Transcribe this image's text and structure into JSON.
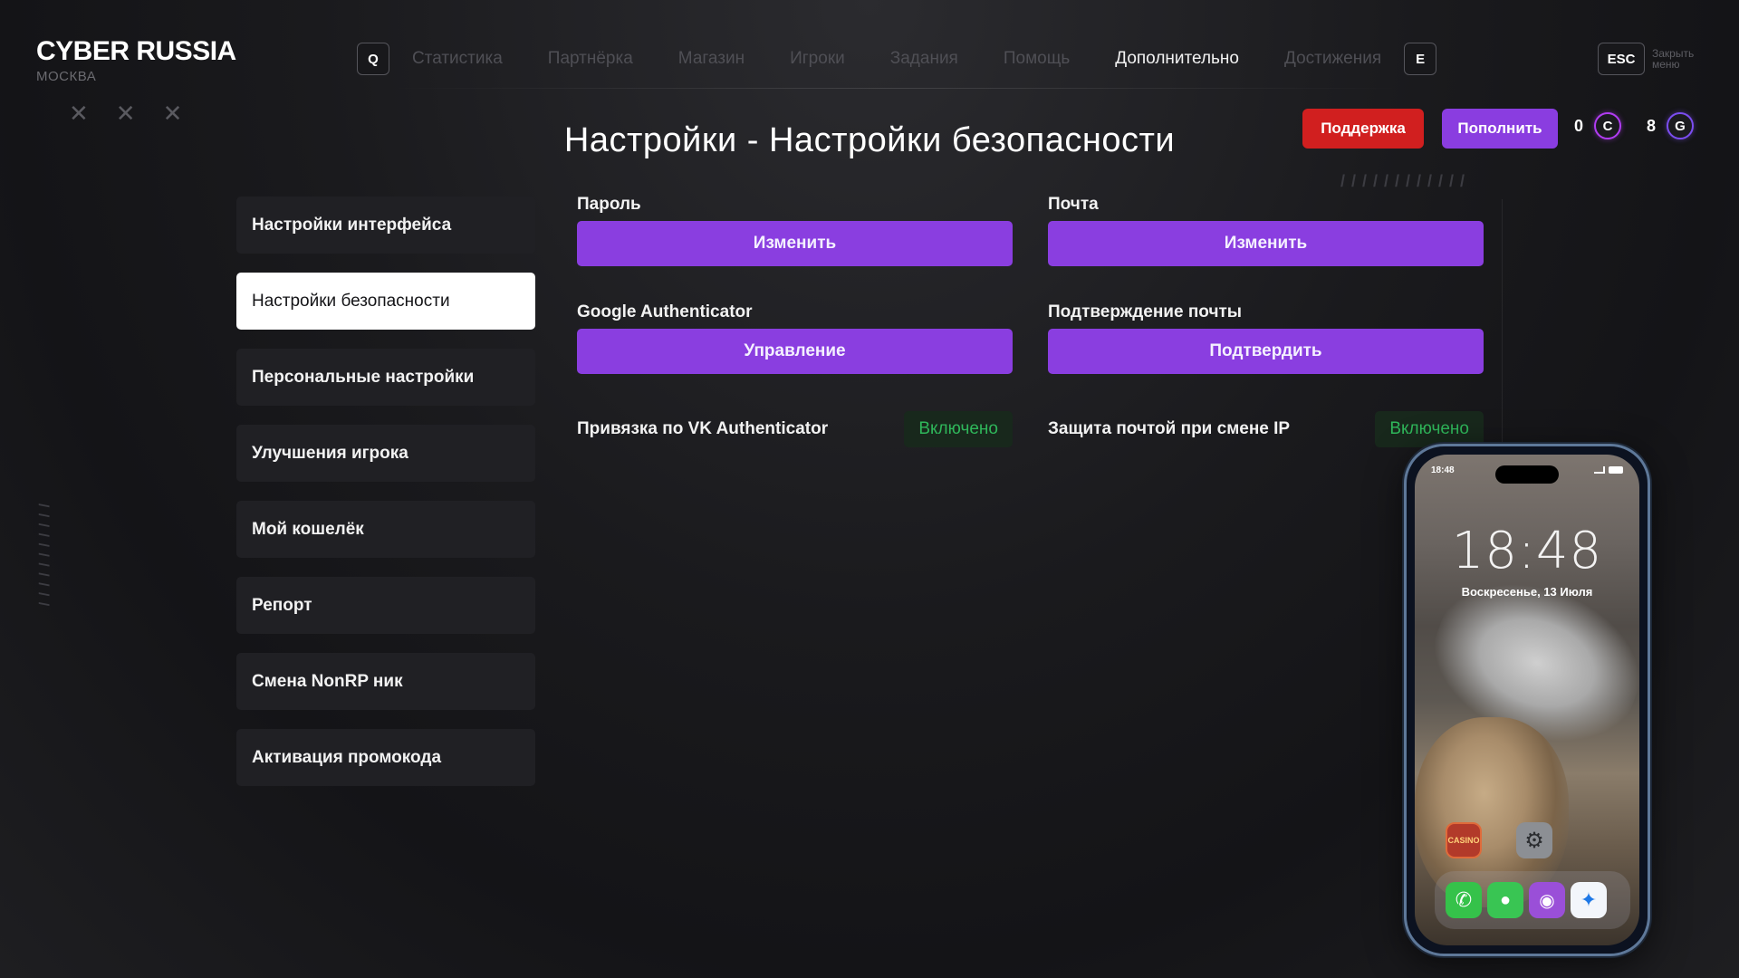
{
  "header": {
    "logo_title": "CYBER RUSSIA",
    "logo_sub": "МОСКВА",
    "key_q": "Q",
    "key_e": "E",
    "nav": [
      {
        "label": "Статистика",
        "active": false
      },
      {
        "label": "Партнёрка",
        "active": false
      },
      {
        "label": "Магазин",
        "active": false
      },
      {
        "label": "Игроки",
        "active": false
      },
      {
        "label": "Задания",
        "active": false
      },
      {
        "label": "Помощь",
        "active": false
      },
      {
        "label": "Дополнительно",
        "active": true
      },
      {
        "label": "Достижения",
        "active": false
      }
    ],
    "esc_key": "ESC",
    "esc_label": "Закрыть меню"
  },
  "title": "Настройки - Настройки безопасности",
  "actions": {
    "support": "Поддержка",
    "topup": "Пополнить",
    "currency_c_value": "0",
    "currency_c_symbol": "C",
    "currency_g_value": "8",
    "currency_g_symbol": "G"
  },
  "sidebar": {
    "items": [
      {
        "label": "Настройки интерфейса",
        "active": false
      },
      {
        "label": "Настройки безопасности",
        "active": true
      },
      {
        "label": "Персональные настройки",
        "active": false
      },
      {
        "label": "Улучшения игрока",
        "active": false
      },
      {
        "label": "Мой кошелёк",
        "active": false
      },
      {
        "label": "Репорт",
        "active": false
      },
      {
        "label": "Смена NonRP ник",
        "active": false
      },
      {
        "label": "Активация промокода",
        "active": false
      }
    ]
  },
  "security": {
    "password": {
      "label": "Пароль",
      "button": "Изменить"
    },
    "email": {
      "label": "Почта",
      "button": "Изменить"
    },
    "google_auth": {
      "label": "Google Authenticator",
      "button": "Управление"
    },
    "email_confirm": {
      "label": "Подтверждение почты",
      "button": "Подтвердить"
    },
    "vk_auth": {
      "label": "Привязка по VK Authenticator",
      "status": "Включено"
    },
    "ip_protect": {
      "label": "Защита почтой при смене IP",
      "status": "Включено"
    }
  },
  "phone": {
    "status_time": "18:48",
    "lock_time": "18:48",
    "lock_date": "Воскресенье, 13 Июля",
    "game_app_label": "CASINO"
  },
  "colors": {
    "accent": "#8a3ee0",
    "support": "#d11f1f",
    "status_on": "#2fb65a"
  }
}
